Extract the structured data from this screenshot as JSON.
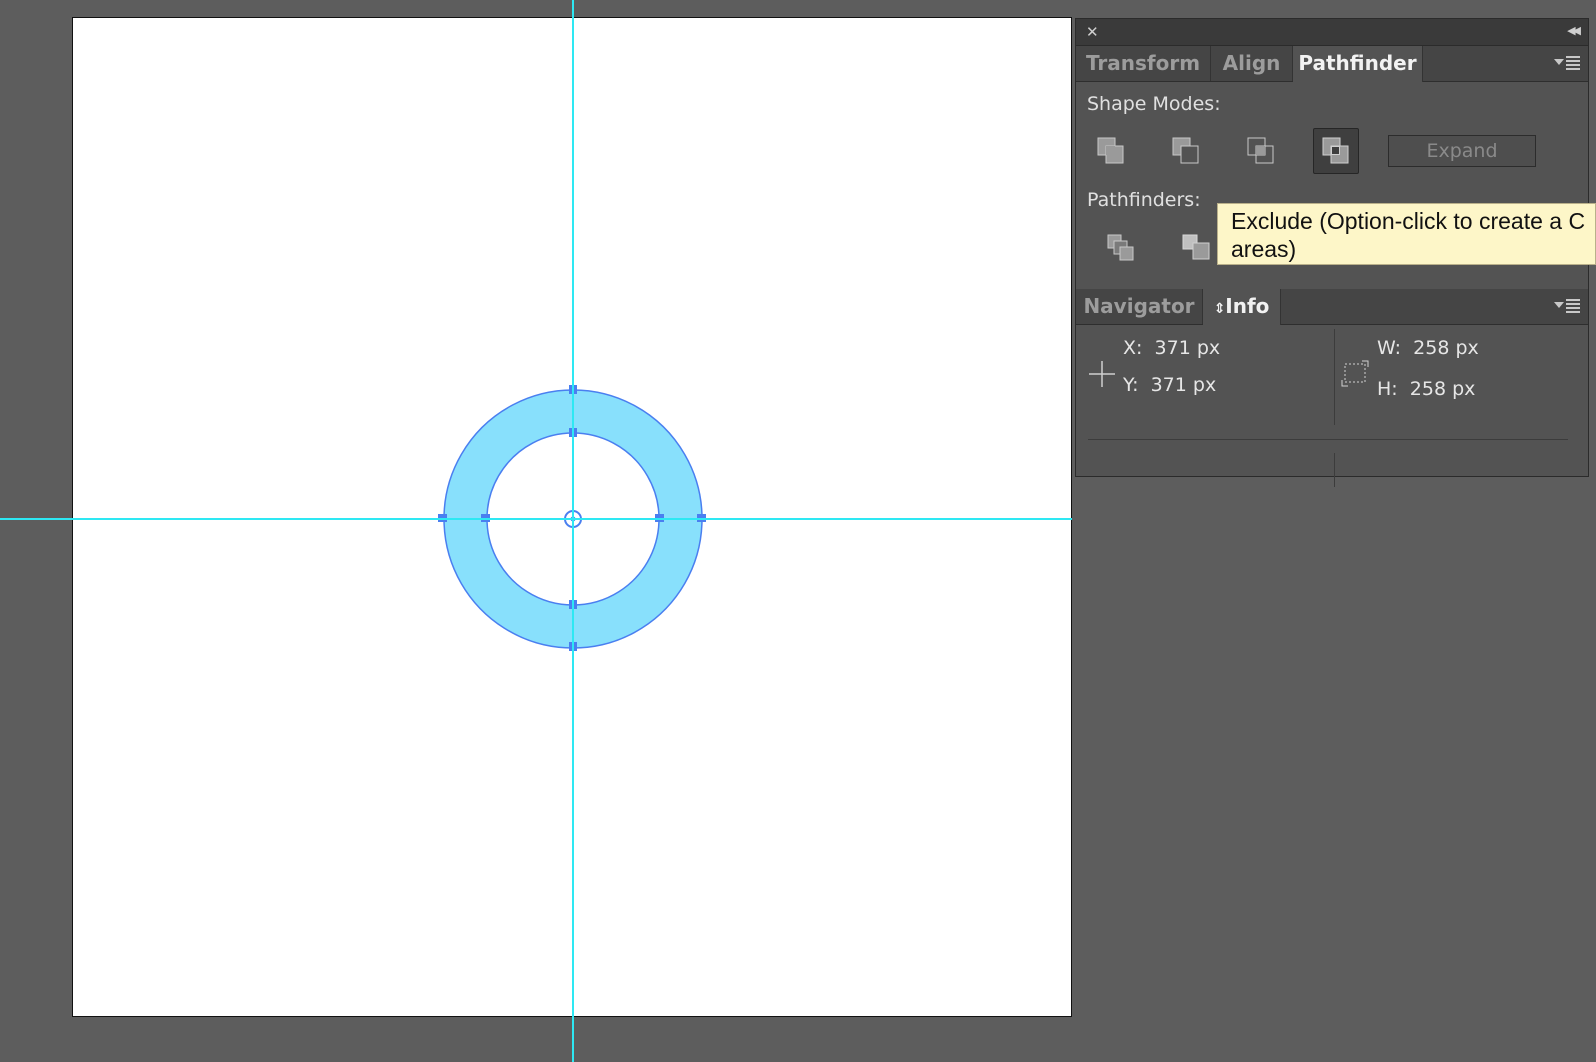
{
  "canvas": {
    "guide_color": "#2ee8f3",
    "ring_fill": "#88e0fc",
    "ring_stroke": "#4a7ff0"
  },
  "panel": {
    "top_tabs": [
      {
        "label": "Transform",
        "active": false
      },
      {
        "label": "Align",
        "active": false
      },
      {
        "label": "Pathfinder",
        "active": true
      }
    ],
    "shape_modes_label": "Shape Modes:",
    "shape_mode_buttons": [
      "unite-icon",
      "minus-front-icon",
      "intersect-icon",
      "exclude-icon"
    ],
    "active_shape_mode": "exclude-icon",
    "expand_label": "Expand",
    "pathfinders_label": "Pathfinders:",
    "pathfinder_buttons": [
      "divide-icon",
      "trim-icon"
    ],
    "tooltip": "Exclude (Option-click to create a C areas)",
    "info_tabs": [
      {
        "label": "Navigator",
        "active": false
      },
      {
        "label": "Info",
        "active": true
      }
    ],
    "info": {
      "x_label": "X:",
      "x_value": "371 px",
      "y_label": "Y:",
      "y_value": "371 px",
      "w_label": "W:",
      "w_value": "258 px",
      "h_label": "H:",
      "h_value": "258 px"
    }
  }
}
